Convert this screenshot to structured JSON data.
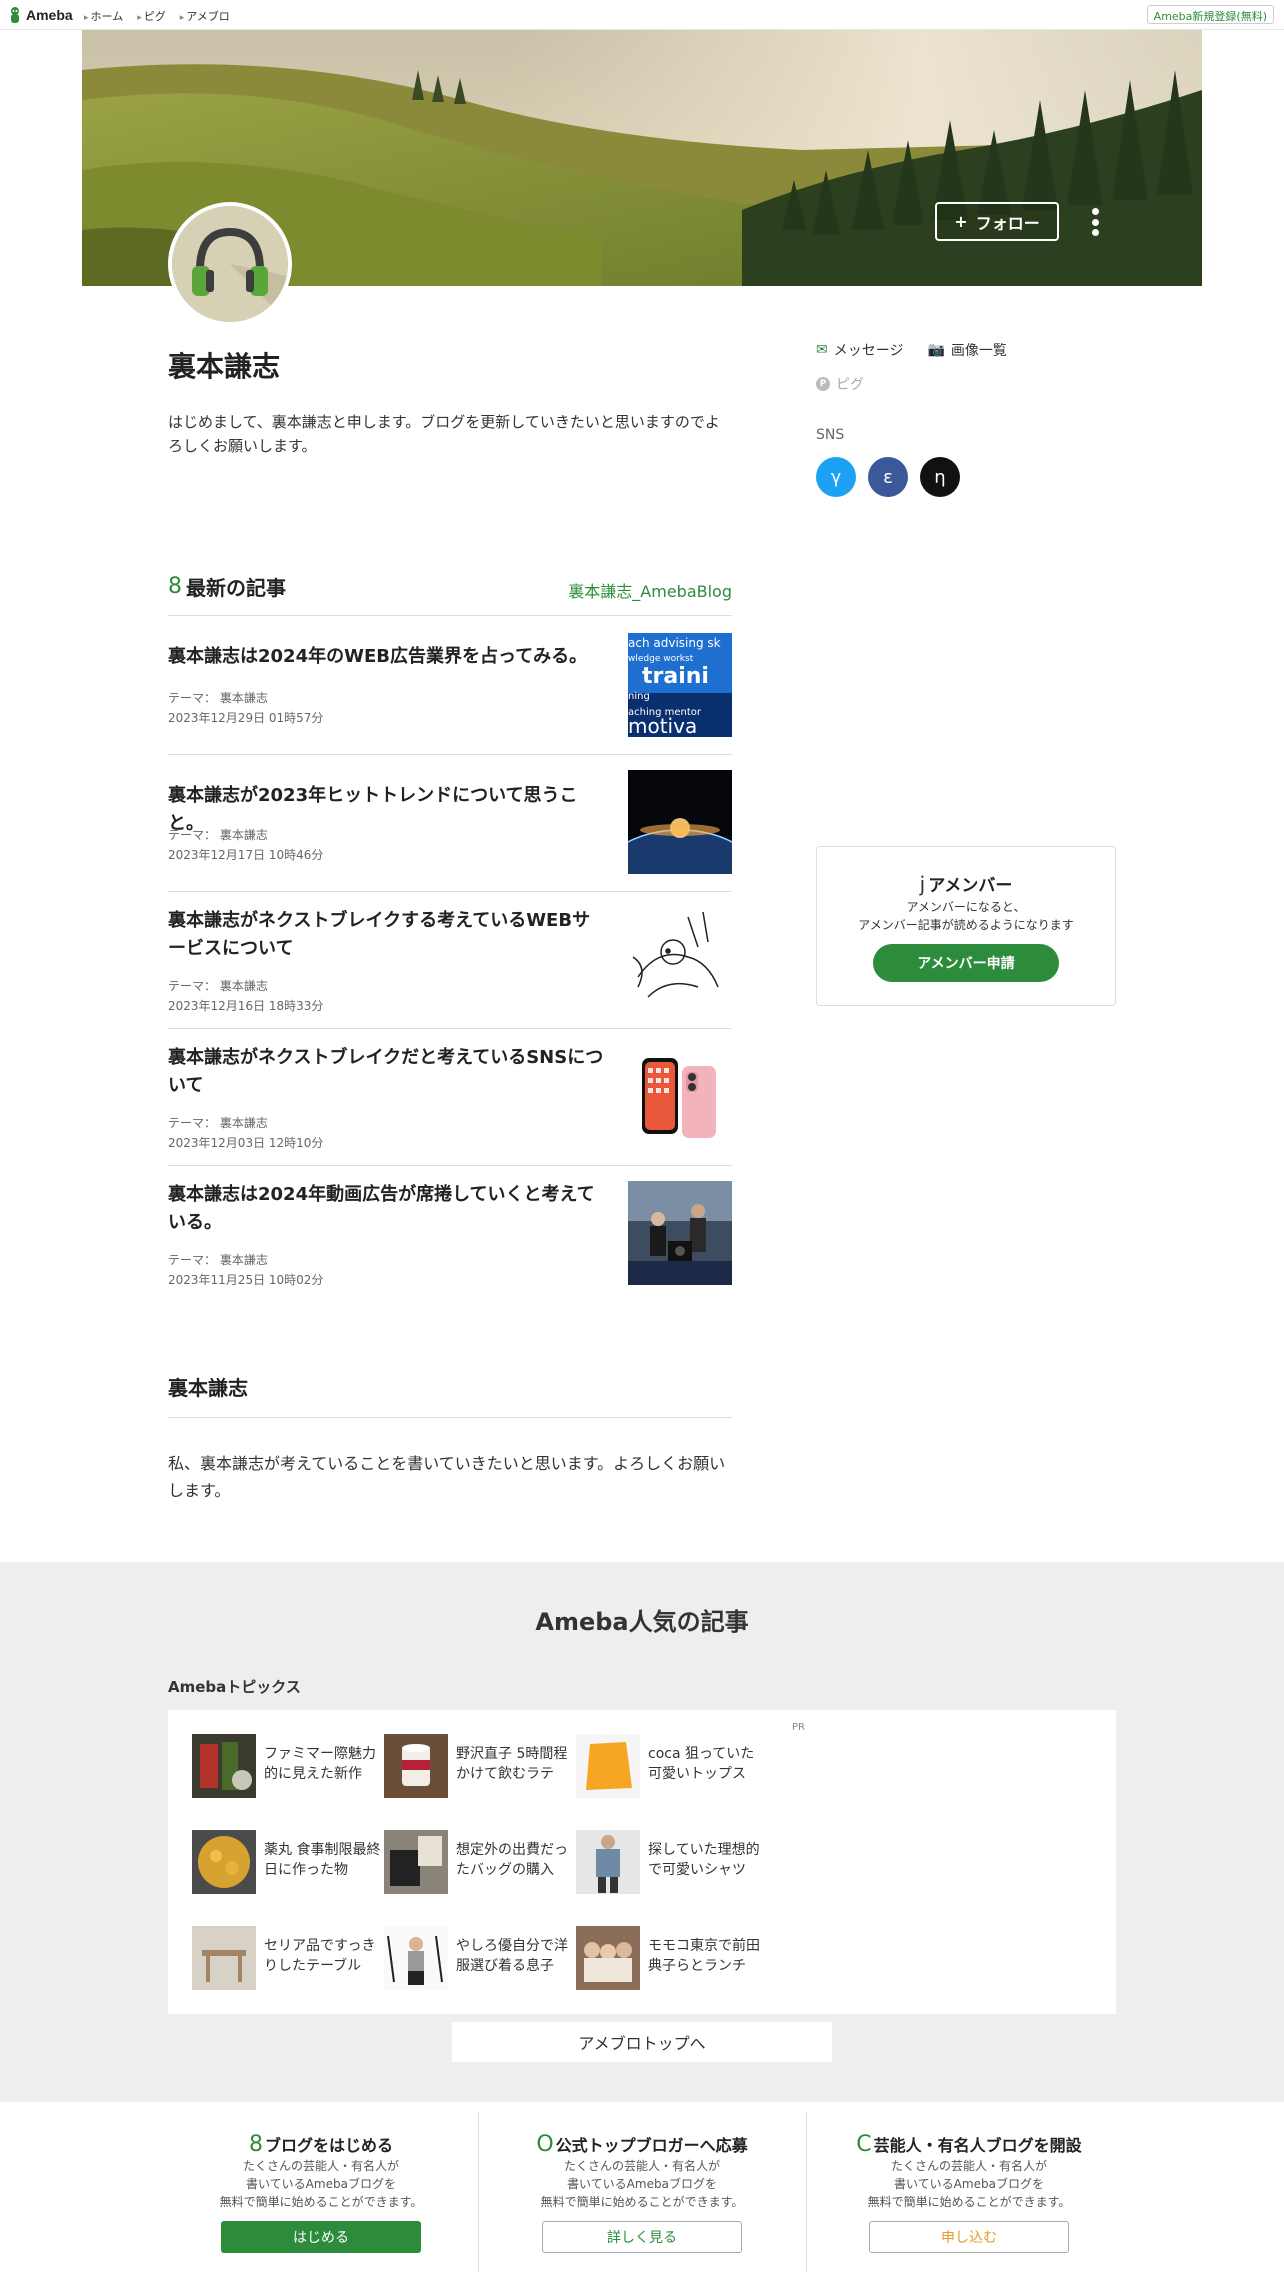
{
  "nav": {
    "logo": "Ameba",
    "links": [
      "ホーム",
      "ピグ",
      "アメブロ"
    ],
    "signup": "Ameba新規登録(無料)"
  },
  "header": {
    "follow": "フォロー",
    "follow_plus": "+"
  },
  "profile": {
    "name": "裏本謙志",
    "bio": "はじめまして、裏本謙志と申します。ブログを更新していきたいと思いますのでよろしくお願いします。",
    "message": "メッセージ",
    "images": "画像一覧",
    "pigg": "ピグ",
    "sns_label": "SNS",
    "sns": [
      {
        "glyph": "γ",
        "color": "#1da1f2"
      },
      {
        "glyph": "ε",
        "color": "#3b5998"
      },
      {
        "glyph": "η",
        "color": "#111111"
      }
    ]
  },
  "latest": {
    "icon": "8",
    "title": "最新の記事",
    "blog_link": "裏本謙志_AmebaBlog",
    "articles": [
      {
        "title": "裏本謙志は2024年のWEB広告業界を占ってみる。",
        "theme": "テーマ： 裏本謙志",
        "date": "2023年12月29日 01時57分"
      },
      {
        "title": "裏本謙志が2023年ヒットトレンドについて思うこと。",
        "theme": "テーマ： 裏本謙志",
        "date": "2023年12月17日 10時46分"
      },
      {
        "title": "裏本謙志がネクストブレイクする考えているWEBサービスについて",
        "theme": "テーマ： 裏本謙志",
        "date": "2023年12月16日 18時33分"
      },
      {
        "title": "裏本謙志がネクストブレイクだと考えているSNSについて",
        "theme": "テーマ： 裏本謙志",
        "date": "2023年12月03日 12時10分"
      },
      {
        "title": "裏本謙志は2024年動画広告が席捲していくと考えている。",
        "theme": "テーマ： 裏本謙志",
        "date": "2023年11月25日 10時02分"
      }
    ],
    "thumb_text": {
      "line1": "ach advising sk",
      "line2": "wledge workst",
      "line3": "traini",
      "line4": "ning",
      "line5": "aching mentor",
      "line6": "motiva"
    }
  },
  "blog": {
    "title": "裏本謙志",
    "desc": "私、裏本謙志が考えていることを書いていきたいと思います。よろしくお願いします。"
  },
  "member": {
    "icon": "j",
    "title": "アメンバー",
    "desc1": "アメンバーになると、",
    "desc2": "アメンバー記事が読めるようになります",
    "button": "アメンバー申請"
  },
  "popular": {
    "title": "Ameba人気の記事",
    "subtitle": "Amebaトピックス",
    "pr": "PR",
    "topics": [
      "ファミマー際魅力的に見えた新作",
      "野沢直子 5時間程かけて飲むラテ",
      "coca 狙っていた可愛いトップス",
      "薬丸 食事制限最終日に作った物",
      "想定外の出費だったバッグの購入",
      "探していた理想的で可愛いシャツ",
      "セリア品ですっきりしたテーブル",
      "やしろ優自分で洋服選び着る息子",
      "モモコ東京で前田典子らとランチ"
    ],
    "to_top": "アメブロトップへ"
  },
  "promos": [
    {
      "icon": "8",
      "title": "ブログをはじめる",
      "desc": [
        "たくさんの芸能人・有名人が",
        "書いているAmebaブログを",
        "無料で簡単に始めることができます。"
      ],
      "button": "はじめる",
      "style": "green"
    },
    {
      "icon": "O",
      "title": "公式トップブロガーへ応募",
      "desc": [
        "たくさんの芸能人・有名人が",
        "書いているAmebaブログを",
        "無料で簡単に始めることができます。"
      ],
      "button": "詳しく見る",
      "style": "outline-green"
    },
    {
      "icon": "C",
      "title": "芸能人・有名人ブログを開設",
      "desc": [
        "たくさんの芸能人・有名人が",
        "書いているAmebaブログを",
        "無料で簡単に始めることができます。"
      ],
      "button": "申し込む",
      "style": "outline-orange"
    }
  ]
}
